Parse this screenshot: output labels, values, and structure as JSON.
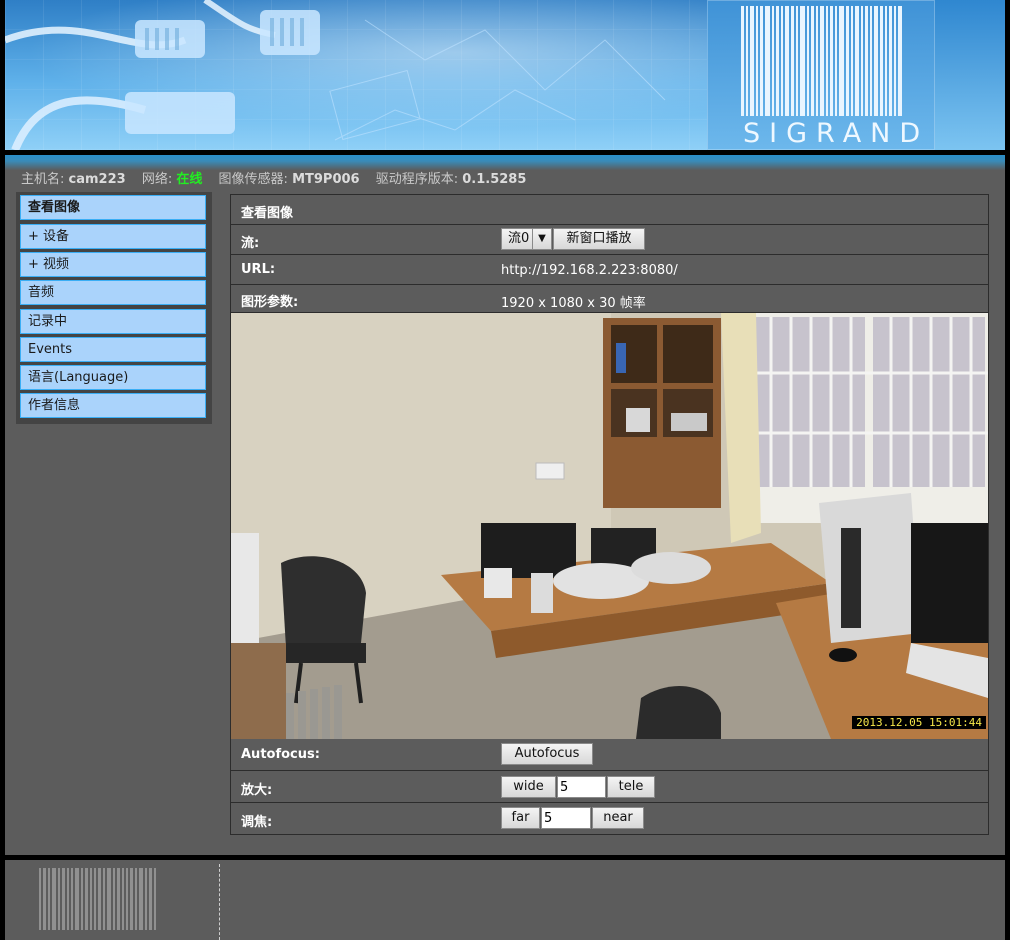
{
  "brand": {
    "logo_text": "SIGRAND"
  },
  "status": {
    "host_label": "主机名:",
    "host_value": "cam223",
    "net_label": "网络:",
    "net_value": "在线",
    "sensor_label": "图像传感器:",
    "sensor_value": "MT9P006",
    "driver_label": "驱动程序版本:",
    "driver_value": "0.1.5285",
    "net_color": "#22ee22"
  },
  "sidebar": {
    "items": [
      {
        "label": "查看图像",
        "active": true
      },
      {
        "label": "+ 设备"
      },
      {
        "label": "+ 视频"
      },
      {
        "label": "音频"
      },
      {
        "label": "记录中"
      },
      {
        "label": "Events"
      },
      {
        "label": "语言(Language)"
      },
      {
        "label": "作者信息"
      }
    ],
    "item_color": "#aad3fb",
    "border_color": "#3aaef5"
  },
  "main": {
    "title": "查看图像",
    "stream": {
      "label": "流:",
      "selected": "流0",
      "popup_button": "新窗口播放"
    },
    "url": {
      "label": "URL:",
      "value": "http://192.168.2.223:8080/"
    },
    "graphics": {
      "label": "图形参数:",
      "value": "1920 x 1080 x 30 帧率"
    },
    "camera": {
      "timestamp": "2013.12.05 15:01:44"
    },
    "autofocus": {
      "label": "Autofocus:",
      "button": "Autofocus"
    },
    "zoom": {
      "label": "放大:",
      "wide": "wide",
      "value": "5",
      "tele": "tele"
    },
    "focus": {
      "label": "调焦:",
      "far": "far",
      "value": "5",
      "near": "near"
    }
  }
}
